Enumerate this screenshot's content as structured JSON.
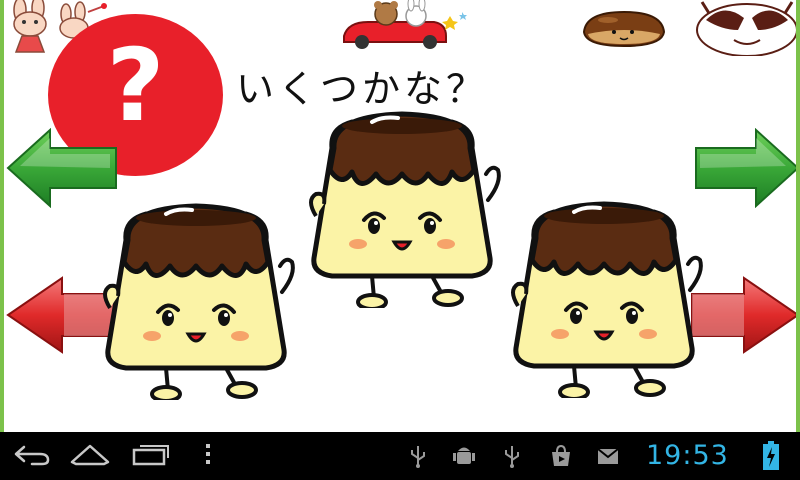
{
  "game": {
    "question": "いくつかな？",
    "help_symbol": "?"
  },
  "nav": {
    "prev_arrow": "arrow-left-green",
    "next_arrow": "arrow-right-green",
    "answer_down": "arrow-left-red",
    "answer_up": "arrow-right-red"
  },
  "header": {
    "icons": [
      "bunny-character-icon",
      "teddy-car-icon",
      "chestnut-icon",
      "cat-face-icon"
    ]
  },
  "status_bar": {
    "time": "19:53",
    "icons": [
      "usb-icon",
      "android-debug-icon",
      "usb-icon",
      "store-icon",
      "gmail-icon",
      "battery-charging-icon"
    ]
  },
  "system_nav": {
    "buttons": [
      "back-icon",
      "home-icon",
      "recents-icon",
      "menu-icon"
    ]
  },
  "colors": {
    "help_red": "#e8202a",
    "arrow_green": "#3aa838",
    "arrow_red": "#e02a2a",
    "clock_blue": "#33b5e5",
    "caramel": "#5a2c12",
    "custard": "#fbf3a6"
  }
}
